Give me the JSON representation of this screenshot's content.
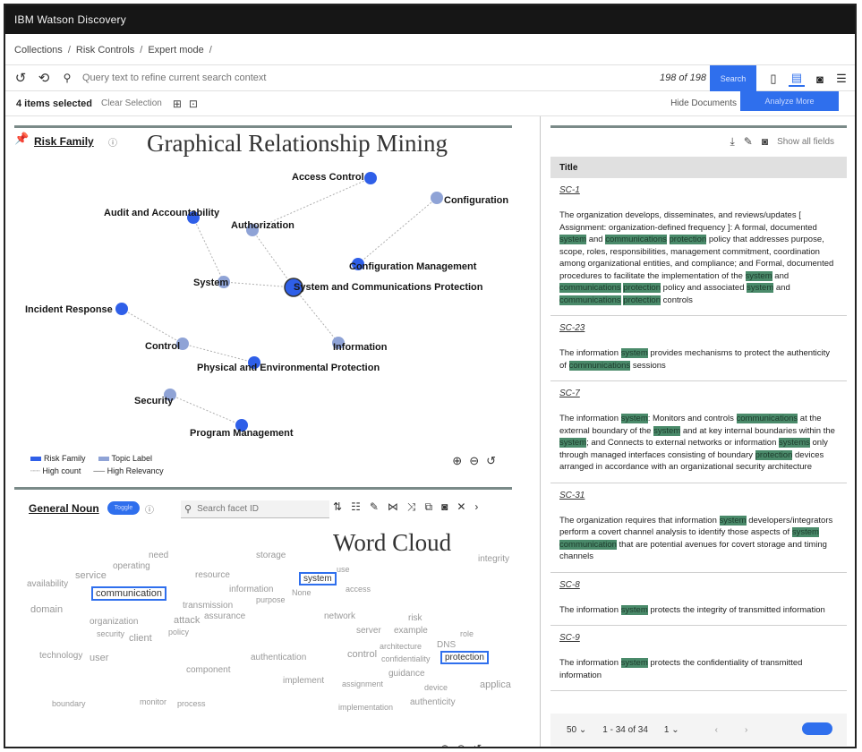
{
  "app": {
    "title": "IBM Watson Discovery"
  },
  "breadcrumb": [
    "Collections",
    "Risk Controls",
    "Expert mode"
  ],
  "query": {
    "placeholder": "Query text to refine current search context",
    "count": "198 of 198",
    "search_label": "Search"
  },
  "selection": {
    "count_label": "4 items selected",
    "clear_label": "Clear Selection",
    "hide_docs": "Hide Documents",
    "analyze_label": "Analyze More"
  },
  "graph": {
    "facet_title": "Risk Family",
    "overlay_title": "Graphical Relationship Mining",
    "nodes": [
      {
        "label": "Access Control",
        "kind": "risk"
      },
      {
        "label": "Configuration",
        "kind": "topic"
      },
      {
        "label": "Audit and Accountability",
        "kind": "risk"
      },
      {
        "label": "Authorization",
        "kind": "topic"
      },
      {
        "label": "Configuration Management",
        "kind": "risk"
      },
      {
        "label": "System",
        "kind": "topic"
      },
      {
        "label": "System and Communications Protection",
        "kind": "risk"
      },
      {
        "label": "Incident Response",
        "kind": "risk"
      },
      {
        "label": "Control",
        "kind": "topic"
      },
      {
        "label": "Information",
        "kind": "topic"
      },
      {
        "label": "Physical and Environmental Protection",
        "kind": "risk"
      },
      {
        "label": "Security",
        "kind": "topic"
      },
      {
        "label": "Program Management",
        "kind": "risk"
      }
    ],
    "edges": [
      [
        "Access Control",
        "Authorization"
      ],
      [
        "Configuration",
        "Configuration Management"
      ],
      [
        "Audit and Accountability",
        "System"
      ],
      [
        "Authorization",
        "System and Communications Protection"
      ],
      [
        "System",
        "System and Communications Protection"
      ],
      [
        "System and Communications Protection",
        "Information"
      ],
      [
        "Incident Response",
        "Control"
      ],
      [
        "Control",
        "Physical and Environmental Protection"
      ],
      [
        "Security",
        "Program Management"
      ]
    ],
    "legend": {
      "risk": "Risk Family",
      "topic": "Topic Label",
      "high_count": "High count",
      "high_relevancy": "High Relevancy"
    },
    "colors": {
      "risk": "#2f5fe8",
      "topic": "#8fa3d6",
      "edge": "#b0b0b0"
    }
  },
  "wordcloud": {
    "facet_title": "General Noun",
    "toggle_label": "Toggle",
    "search_placeholder": "Search facet ID",
    "overlay_title": "Word Cloud",
    "words": [
      "need",
      "storage",
      "integrity",
      "operating",
      "service",
      "resource",
      "system",
      "use",
      "availability",
      "communication",
      "information",
      "None",
      "access",
      "purpose",
      "domain",
      "transmission",
      "organization",
      "attack",
      "assurance",
      "network",
      "risk",
      "security",
      "client",
      "policy",
      "server",
      "example",
      "role",
      "technology",
      "user",
      "authentication",
      "control",
      "architecture",
      "confidentiality",
      "DNS",
      "protection",
      "component",
      "implement",
      "guidance",
      "assignment",
      "applica",
      "boundary",
      "monitor",
      "process",
      "device",
      "authenticity",
      "implementation"
    ],
    "selected": [
      "system",
      "communication",
      "protection"
    ]
  },
  "results": {
    "tools": {
      "show_all": "Show all fields"
    },
    "column_title": "Title",
    "items": [
      {
        "id": "SC-1",
        "segments": [
          [
            "The organization develops, disseminates, and reviews/updates [ Assignment: organization-defined frequency ]: A formal, documented ",
            false
          ],
          [
            "system",
            true
          ],
          [
            " and ",
            false
          ],
          [
            "communications",
            true
          ],
          [
            " ",
            false
          ],
          [
            "protection",
            true
          ],
          [
            " policy that addresses purpose, scope, roles, responsibilities, management commitment, coordination among organizational entities, and compliance; and Formal, documented procedures to facilitate the implementation of the ",
            false
          ],
          [
            "system",
            true
          ],
          [
            " and ",
            false
          ],
          [
            "communications",
            true
          ],
          [
            " ",
            false
          ],
          [
            "protection",
            true
          ],
          [
            " policy and associated ",
            false
          ],
          [
            "system",
            true
          ],
          [
            " and ",
            false
          ],
          [
            "communications",
            true
          ],
          [
            " ",
            false
          ],
          [
            "protection",
            true
          ],
          [
            " controls",
            false
          ]
        ]
      },
      {
        "id": "SC-23",
        "segments": [
          [
            "The information ",
            false
          ],
          [
            "system",
            true
          ],
          [
            " provides mechanisms to protect the authenticity of ",
            false
          ],
          [
            "communications",
            true
          ],
          [
            " sessions",
            false
          ]
        ]
      },
      {
        "id": "SC-7",
        "segments": [
          [
            "The information ",
            false
          ],
          [
            "system",
            true
          ],
          [
            ": Monitors and controls ",
            false
          ],
          [
            "communications",
            true
          ],
          [
            " at the external boundary of the ",
            false
          ],
          [
            "system",
            true
          ],
          [
            " and at key internal boundaries within the ",
            false
          ],
          [
            "system",
            true
          ],
          [
            "; and Connects to external networks or information ",
            false
          ],
          [
            "systems",
            true
          ],
          [
            " only through managed interfaces consisting of boundary ",
            false
          ],
          [
            "protection",
            true
          ],
          [
            " devices arranged in accordance with an organizational security architecture",
            false
          ]
        ]
      },
      {
        "id": "SC-31",
        "segments": [
          [
            "The organization requires that information ",
            false
          ],
          [
            "system",
            true
          ],
          [
            " developers/integrators perform a covert channel analysis to identify those aspects of ",
            false
          ],
          [
            "system",
            true
          ],
          [
            " ",
            false
          ],
          [
            "communication",
            true
          ],
          [
            " that are potential avenues for covert storage and timing channels",
            false
          ]
        ]
      },
      {
        "id": "SC-8",
        "segments": [
          [
            "The information ",
            false
          ],
          [
            "system",
            true
          ],
          [
            " protects the integrity of transmitted information",
            false
          ]
        ]
      },
      {
        "id": "SC-9",
        "segments": [
          [
            "The information ",
            false
          ],
          [
            "system",
            true
          ],
          [
            " protects the confidentiality of transmitted information",
            false
          ]
        ]
      }
    ],
    "pager": {
      "per_page": "50",
      "range": "1 - 34 of 34",
      "page": "1"
    }
  }
}
